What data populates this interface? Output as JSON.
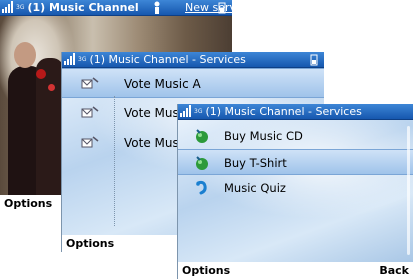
{
  "screen1": {
    "title": "(1) Music Channel",
    "network": "3G",
    "header_link": "New service",
    "softkey_left": "Options"
  },
  "screen2": {
    "title": "(1) Music Channel - Services",
    "network": "3G",
    "items": [
      {
        "label": "Vote Music A",
        "selected": true,
        "icon": "envelope-icon"
      },
      {
        "label": "Vote Mus",
        "selected": false,
        "icon": "envelope-icon"
      },
      {
        "label": "Vote Mus",
        "selected": false,
        "icon": "envelope-icon"
      }
    ],
    "softkey_left": "Options"
  },
  "screen3": {
    "title": "(1) Music Channel - Services",
    "network": "3G",
    "items": [
      {
        "label": "Buy Music CD",
        "selected": false,
        "icon": "green-globe-icon"
      },
      {
        "label": "Buy T-Shirt",
        "selected": true,
        "icon": "green-globe-icon"
      },
      {
        "label": "Music Quiz",
        "selected": false,
        "icon": "blue-hook-icon"
      }
    ],
    "softkey_left": "Options",
    "softkey_right": "Back"
  },
  "colors": {
    "statusbar": "#1f63b8",
    "selection": "#a9c9ee",
    "background": "#cfe2f5"
  }
}
